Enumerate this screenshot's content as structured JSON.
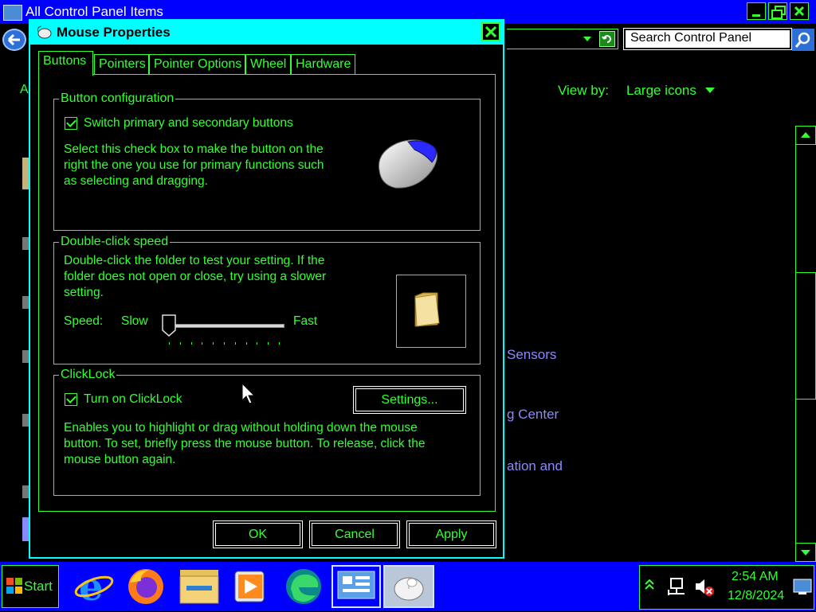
{
  "control_panel": {
    "title": "All Control Panel Items",
    "search_placeholder": "Search Control Panel",
    "view_by_label": "View by:",
    "view_by_value": "Large icons",
    "left_letter": "A",
    "items": [
      "Sensors",
      "g Center",
      "ation and"
    ]
  },
  "dialog": {
    "title": "Mouse Properties",
    "tabs": [
      "Buttons",
      "Pointers",
      "Pointer Options",
      "Wheel",
      "Hardware"
    ],
    "active_tab": "Buttons",
    "button_configuration": {
      "legend": "Button configuration",
      "checkbox_label": "Switch primary and secondary buttons",
      "checked": true,
      "description": [
        "Select this check box to make the button on the",
        "right the one you use for primary functions such",
        "as selecting and dragging."
      ]
    },
    "double_click": {
      "legend": "Double-click speed",
      "description": [
        "Double-click the folder to test your setting. If the",
        "folder does not open or close, try using a slower",
        "setting."
      ],
      "speed_label": "Speed:",
      "slow_label": "Slow",
      "fast_label": "Fast",
      "speed_level": 0.0
    },
    "clicklock": {
      "legend": "ClickLock",
      "checkbox_label": "Turn on ClickLock",
      "checked": true,
      "settings_button": "Settings...",
      "description": [
        "Enables you to highlight or drag without holding down the mouse",
        "button. To set, briefly press the mouse button. To release, click the",
        "mouse button again."
      ]
    },
    "buttons": {
      "ok": "OK",
      "cancel": "Cancel",
      "apply": "Apply"
    }
  },
  "taskbar": {
    "start_label": "Start",
    "apps": [
      "internet-explorer-icon",
      "firefox-icon",
      "file-explorer-icon",
      "media-player-icon",
      "edge-icon",
      "control-panel-icon",
      "mouse-icon"
    ],
    "clock_time": "2:54 AM",
    "clock_date": "12/8/2024"
  },
  "colors": {
    "text": "#33ff33",
    "dialog_title_bg": "#00ffff",
    "titlebar_bg": "#0000ff",
    "link": "#8a8aff"
  }
}
